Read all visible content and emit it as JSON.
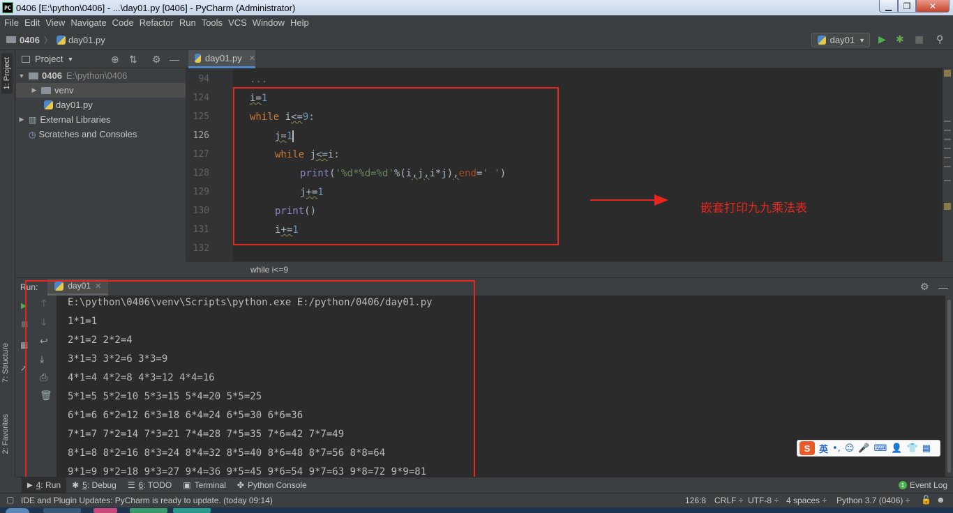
{
  "window": {
    "title": "0406 [E:\\python\\0406] - ...\\day01.py [0406] - PyCharm (Administrator)",
    "app_icon": "PC"
  },
  "menu": [
    "File",
    "Edit",
    "View",
    "Navigate",
    "Code",
    "Refactor",
    "Run",
    "Tools",
    "VCS",
    "Window",
    "Help"
  ],
  "navbar": {
    "project": "0406",
    "file": "day01.py",
    "run_config": "day01"
  },
  "side_tabs": {
    "project": "1: Project",
    "structure": "7: Structure",
    "favorites": "2: Favorites"
  },
  "project_panel": {
    "header": "Project",
    "root_name": "0406",
    "root_path": "E:\\python\\0406",
    "venv": "venv",
    "file": "day01.py",
    "external": "External Libraries",
    "scratches": "Scratches and Consoles"
  },
  "editor": {
    "tab": "day01.py",
    "fold_placeholder": "...",
    "line_numbers": [
      "94",
      "124",
      "125",
      "126",
      "127",
      "128",
      "129",
      "130",
      "131",
      "132"
    ],
    "current_line": "126",
    "breadcrumb": "while i<=9"
  },
  "annotation": {
    "text": "嵌套打印九九乘法表",
    "color": "#e8261e"
  },
  "run_panel": {
    "label": "Run:",
    "tab": "day01",
    "command": "E:\\python\\0406\\venv\\Scripts\\python.exe E:/python/0406/day01.py",
    "output": [
      "1*1=1",
      "2*1=2 2*2=4",
      "3*1=3 3*2=6 3*3=9",
      "4*1=4 4*2=8 4*3=12 4*4=16",
      "5*1=5 5*2=10 5*3=15 5*4=20 5*5=25",
      "6*1=6 6*2=12 6*3=18 6*4=24 6*5=30 6*6=36",
      "7*1=7 7*2=14 7*3=21 7*4=28 7*5=35 7*6=42 7*7=49",
      "8*1=8 8*2=16 8*3=24 8*4=32 8*5=40 8*6=48 8*7=56 8*8=64",
      "9*1=9 9*2=18 9*3=27 9*4=36 9*5=45 9*6=54 9*7=63 9*8=72 9*9=81"
    ]
  },
  "bottom_tools": {
    "run_num": "4",
    "run": ": Run",
    "debug_num": "5",
    "debug": ": Debug",
    "todo_num": "6",
    "todo": ": TODO",
    "terminal": "Terminal",
    "python_console": "Python Console",
    "event_log": "Event Log",
    "event_count": "1"
  },
  "status": {
    "message": "IDE and Plugin Updates: PyCharm is ready to update. (today 09:14)",
    "position": "126:8",
    "line_sep": "CRLF ÷",
    "encoding": "UTF-8 ÷",
    "indent": "4 spaces ÷",
    "interpreter": "Python 3.7 (0406) ÷"
  },
  "ime": {
    "logo": "S",
    "mode": "英"
  }
}
